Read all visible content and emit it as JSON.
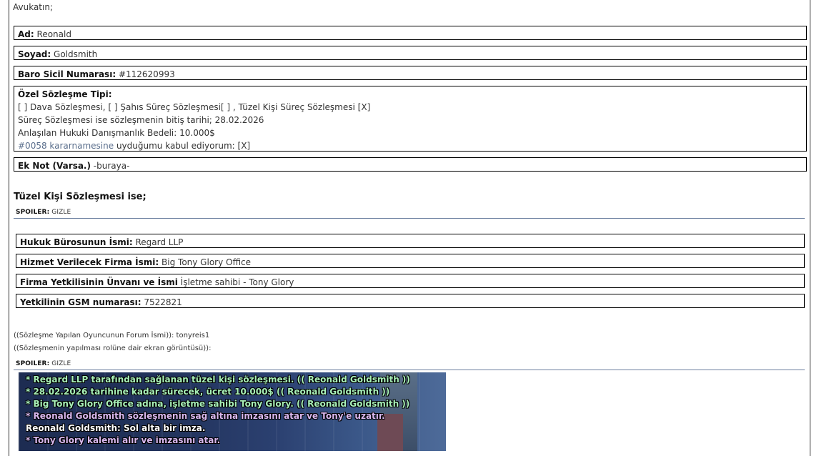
{
  "greeting": "Avukatın;",
  "fields": {
    "ad": {
      "label": "Ad:",
      "value": "Reonald"
    },
    "soyad": {
      "label": "Soyad:",
      "value": "Goldsmith"
    },
    "baro": {
      "label": "Baro Sicil Numarası:",
      "value": "#112620993"
    },
    "ozel": {
      "label": "Özel Sözleşme Tipi:",
      "lines": [
        "[ ] Dava Sözleşmesi, [ ] Şahıs Süreç Sözleşmesi[ ] , Tüzel Kişi Süreç Sözleşmesi [X]",
        "Süreç Sözleşmesi ise sözleşmenin bitiş tarihi; 28.02.2026",
        "Anlaşılan Hukuki Danışmanlık Bedeli: 10.000$"
      ],
      "decree_link": "#0058 kararnamesine",
      "decree_rest": " uyduğumu kabul ediyorum: [X]"
    },
    "eknot": {
      "label": "Ek Not (Varsa.)",
      "value": " -buraya-"
    }
  },
  "corporate": {
    "title": "Tüzel Kişi Sözleşmesi ise;",
    "spoiler_label": "SPOILER:",
    "spoiler_toggle": "GIZLE",
    "rows": [
      {
        "label": "Hukuk Bürosunun İsmi:",
        "value": "Regard LLP"
      },
      {
        "label": "Hizmet Verilecek Firma İsmi:",
        "value": "Big Tony Glory Office"
      },
      {
        "label": "Firma Yetkilisinin Ünvanı ve İsmi",
        "value": "İşletme sahibi - Tony Glory"
      },
      {
        "label": "Yetkilinin GSM numarası:",
        "value": "7522821"
      }
    ]
  },
  "ooc": {
    "forum_name": "((Sözleşme Yapılan Oyuncunun Forum İsmi)): tonyreis1",
    "screenshot": "((Sözleşmenin yapılması rolüne dair ekran görüntüsü)):",
    "spoiler_label": "SPOILER:",
    "spoiler_toggle": "GIZLE"
  },
  "game_chat": {
    "lines": [
      {
        "text": "* Regard LLP tarafından sağlanan tüzel kişi sözleşmesi. (( Reonald Goldsmith ))",
        "color": "#a8f0b8"
      },
      {
        "text": "* 28.02.2026 tarihine kadar sürecek, ücret 10.000$ (( Reonald Goldsmith ))",
        "color": "#a8f0b8"
      },
      {
        "text": "* Big Tony Glory Office adına, işletme sahibi Tony Glory. (( Reonald Goldsmith ))",
        "color": "#a8f0b8"
      },
      {
        "text": "* Reonald Goldsmith sözleşmenin sağ altına imzasını atar ve Tony'e uzatır.",
        "color": "#d9b8ef"
      },
      {
        "text": "Reonald Goldsmith: Sol alta bir imza.",
        "color": "#ffffff"
      },
      {
        "text": "* Tony Glory kalemi alır ve imzasını atar.",
        "color": "#d9b8ef"
      }
    ]
  },
  "colors": {
    "rule": "#6b7f9f",
    "link": "#5a6e8c"
  }
}
